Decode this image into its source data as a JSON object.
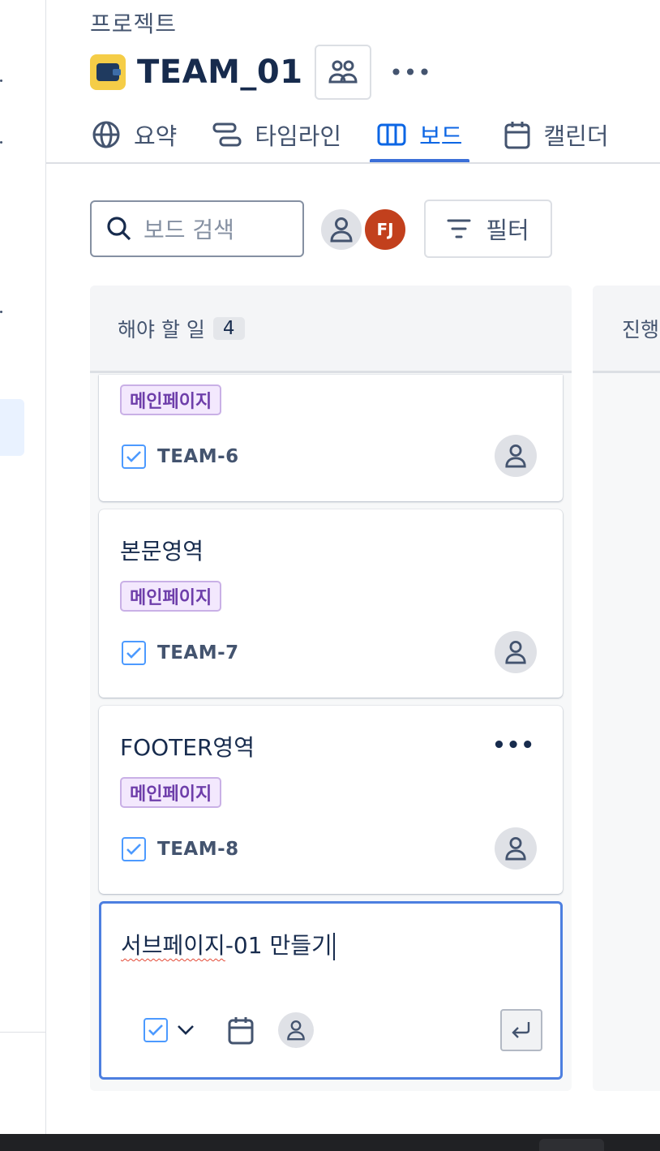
{
  "breadcrumb": "프로젝트",
  "project": {
    "title": "TEAM_01",
    "more": "•••"
  },
  "tabs": [
    {
      "label": "요약",
      "icon": "globe-icon"
    },
    {
      "label": "타임라인",
      "icon": "timeline-icon"
    },
    {
      "label": "보드",
      "icon": "board-icon",
      "active": true
    },
    {
      "label": "캘린더",
      "icon": "calendar-icon"
    }
  ],
  "toolbar": {
    "search_placeholder": "보드 검색",
    "avatar_initials": "FJ",
    "filter_label": "필터"
  },
  "columns": [
    {
      "name": "해야 할 일",
      "count": "4"
    },
    {
      "name": "진행"
    }
  ],
  "cards": [
    {
      "title": "",
      "label": "메인페이지",
      "key": "TEAM-6"
    },
    {
      "title": "본문영역",
      "label": "메인페이지",
      "key": "TEAM-7"
    },
    {
      "title": "FOOTER영역",
      "label": "메인페이지",
      "key": "TEAM-8",
      "more": "•••"
    }
  ],
  "new_card": {
    "text_underlined": "서브페이지",
    "text_rest": "-01 만들기"
  },
  "colors": {
    "accent": "#0c66e4",
    "label_bg": "#f3e8fd",
    "label_text": "#6e3eaa",
    "avatar_fj": "#c2401d",
    "project_icon": "#f5cd47"
  }
}
